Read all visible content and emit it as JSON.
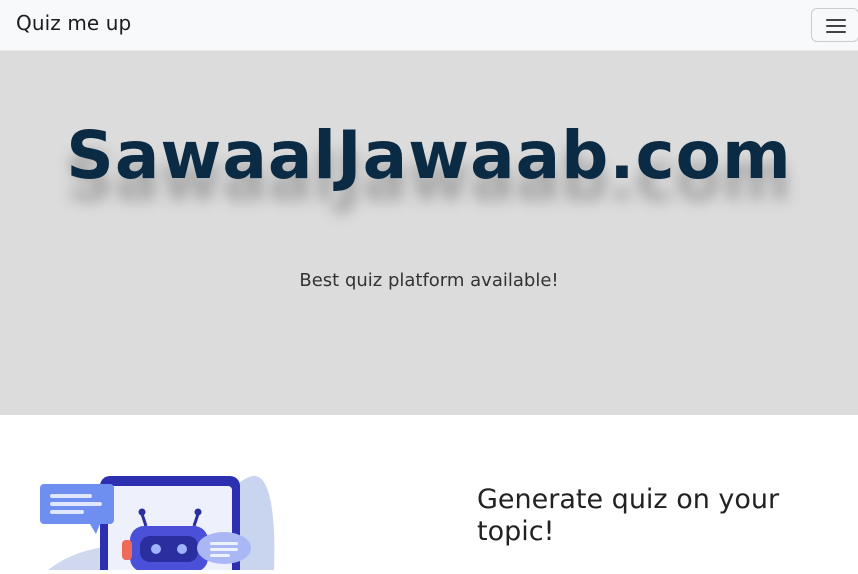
{
  "navbar": {
    "brand": "Quiz me up",
    "toggler_icon": "hamburger-icon"
  },
  "hero": {
    "title": "SawaalJawaab.com",
    "subtitle": "Best quiz platform available!"
  },
  "feature": {
    "heading": "Generate quiz on your topic!",
    "illustration": "chatbot-illustration"
  },
  "colors": {
    "hero_bg": "#dcdcdc",
    "title": "#0b2a44",
    "navbar_bg": "#f8f9fa"
  }
}
